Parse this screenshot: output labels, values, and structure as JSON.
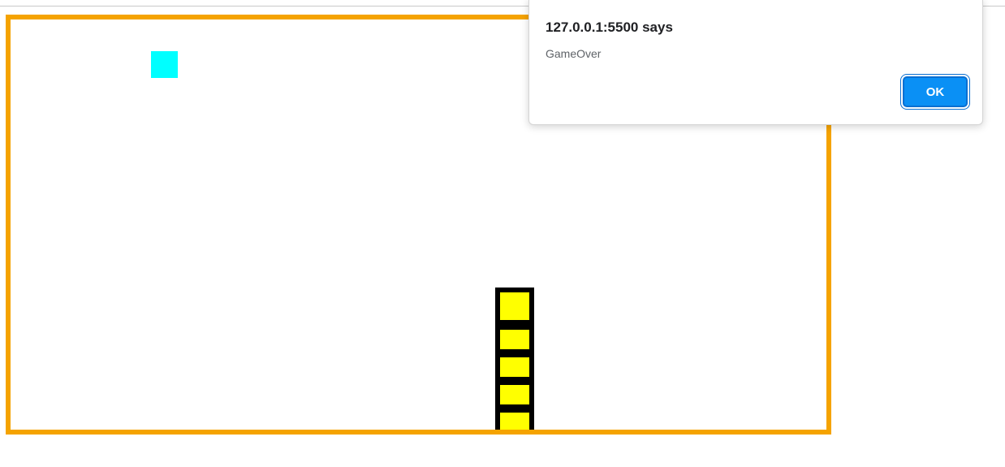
{
  "game": {
    "board_border_color": "#f5a300",
    "food_color": "#00ffff",
    "snake_fill_color": "#ffff00",
    "snake_outline_color": "#000000",
    "snake_segments": 5
  },
  "alert": {
    "title": "127.0.0.1:5500 says",
    "message": "GameOver",
    "ok_label": "OK",
    "button_color": "#0a90f5"
  }
}
